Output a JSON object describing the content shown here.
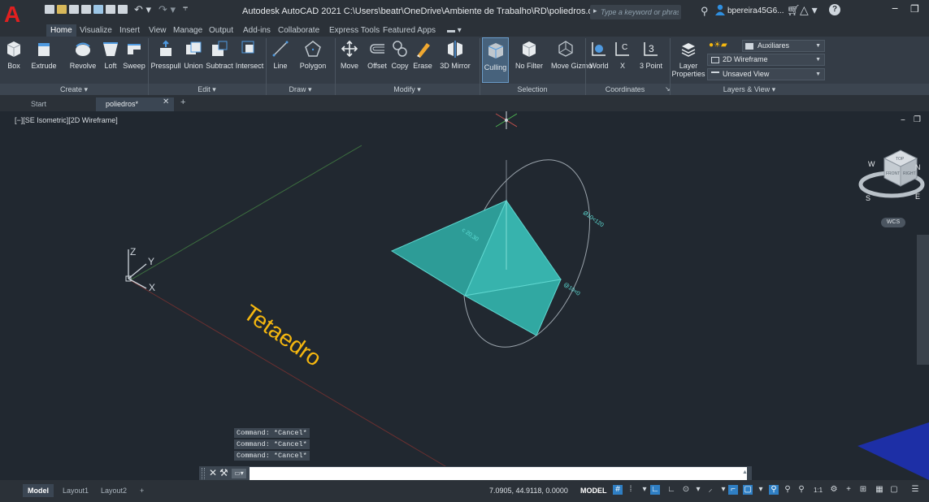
{
  "window": {
    "title": "Autodesk AutoCAD 2021   C:\\Users\\beatr\\OneDrive\\Ambiente de Trabalho\\RD\\poliedros.dwg",
    "logo": "A",
    "search_placeholder": "Type a keyword or phrase",
    "user": "bpereira45G6...",
    "icons": [
      "search-icon",
      "user-icon",
      "cart-icon",
      "a360-icon",
      "help-icon",
      "minimize-icon",
      "restore-icon"
    ]
  },
  "ribbon": {
    "tabs": [
      "Home",
      "Visualize",
      "Insert",
      "View",
      "Manage",
      "Output",
      "Add-ins",
      "Collaborate",
      "Express Tools",
      "Featured Apps"
    ],
    "active_tab": "Home",
    "create": {
      "title": "Create ▾",
      "tools": [
        "Box",
        "Extrude",
        "Revolve",
        "Loft",
        "Sweep"
      ]
    },
    "edit": {
      "title": "Edit ▾",
      "tools": [
        "Presspull",
        "Union",
        "Subtract",
        "Intersect"
      ]
    },
    "draw": {
      "title": "Draw ▾",
      "tools": [
        "Line",
        "Polygon"
      ]
    },
    "modify": {
      "title": "Modify ▾",
      "tools": [
        "Move",
        "Offset",
        "Copy",
        "Erase",
        "3D Mirror"
      ]
    },
    "selection": {
      "title": "Selection",
      "tools": [
        "Culling",
        "No Filter",
        "Move Gizmo"
      ]
    },
    "coordinates": {
      "title": "Coordinates",
      "tools": [
        "World",
        "X",
        "3 Point"
      ],
      "expand": "↘"
    },
    "layers": {
      "title": "Layers & View ▾",
      "tool": "Layer Properties",
      "layer_combo": "Auxiliares",
      "visual_style": "2D Wireframe",
      "view": "Unsaved View",
      "accent": "#f5b70f"
    }
  },
  "file_tabs": {
    "start": "Start",
    "drawing": "poliedros*",
    "close": "✕",
    "add": "+"
  },
  "viewport": {
    "label": "[−][SE Isometric][2D Wireframe]",
    "text_object": "Tetaedro",
    "text_color": "#f5b70f",
    "solid_color": "#37b3ad",
    "ucs_labels": {
      "z": "Z",
      "y": "Y",
      "x": "X"
    },
    "viewcube": {
      "top": "TOP",
      "front": "FRONT",
      "right": "RIGHT",
      "compass_w": "W",
      "compass_s": "S",
      "compass_e": "E",
      "compass_n": "N"
    },
    "wcs": "WCS",
    "annotations": [
      "c 20,30",
      "Ø10<120",
      "@10<0"
    ],
    "controls": {
      "minimize": "−",
      "restore": "ㅁ"
    }
  },
  "command": {
    "history": [
      "Command: *Cancel*",
      "Command: *Cancel*",
      "Command: *Cancel*"
    ],
    "input_value": "",
    "prompt_icon": "▭▾",
    "close": "✕",
    "wrench": "⚒",
    "expand": "▲"
  },
  "status": {
    "layout_tabs": [
      "Model",
      "Layout1",
      "Layout2",
      "+"
    ],
    "coords": "7.0905, 44.9118, 0.0000",
    "mode": "MODEL",
    "scale": "1:1"
  }
}
